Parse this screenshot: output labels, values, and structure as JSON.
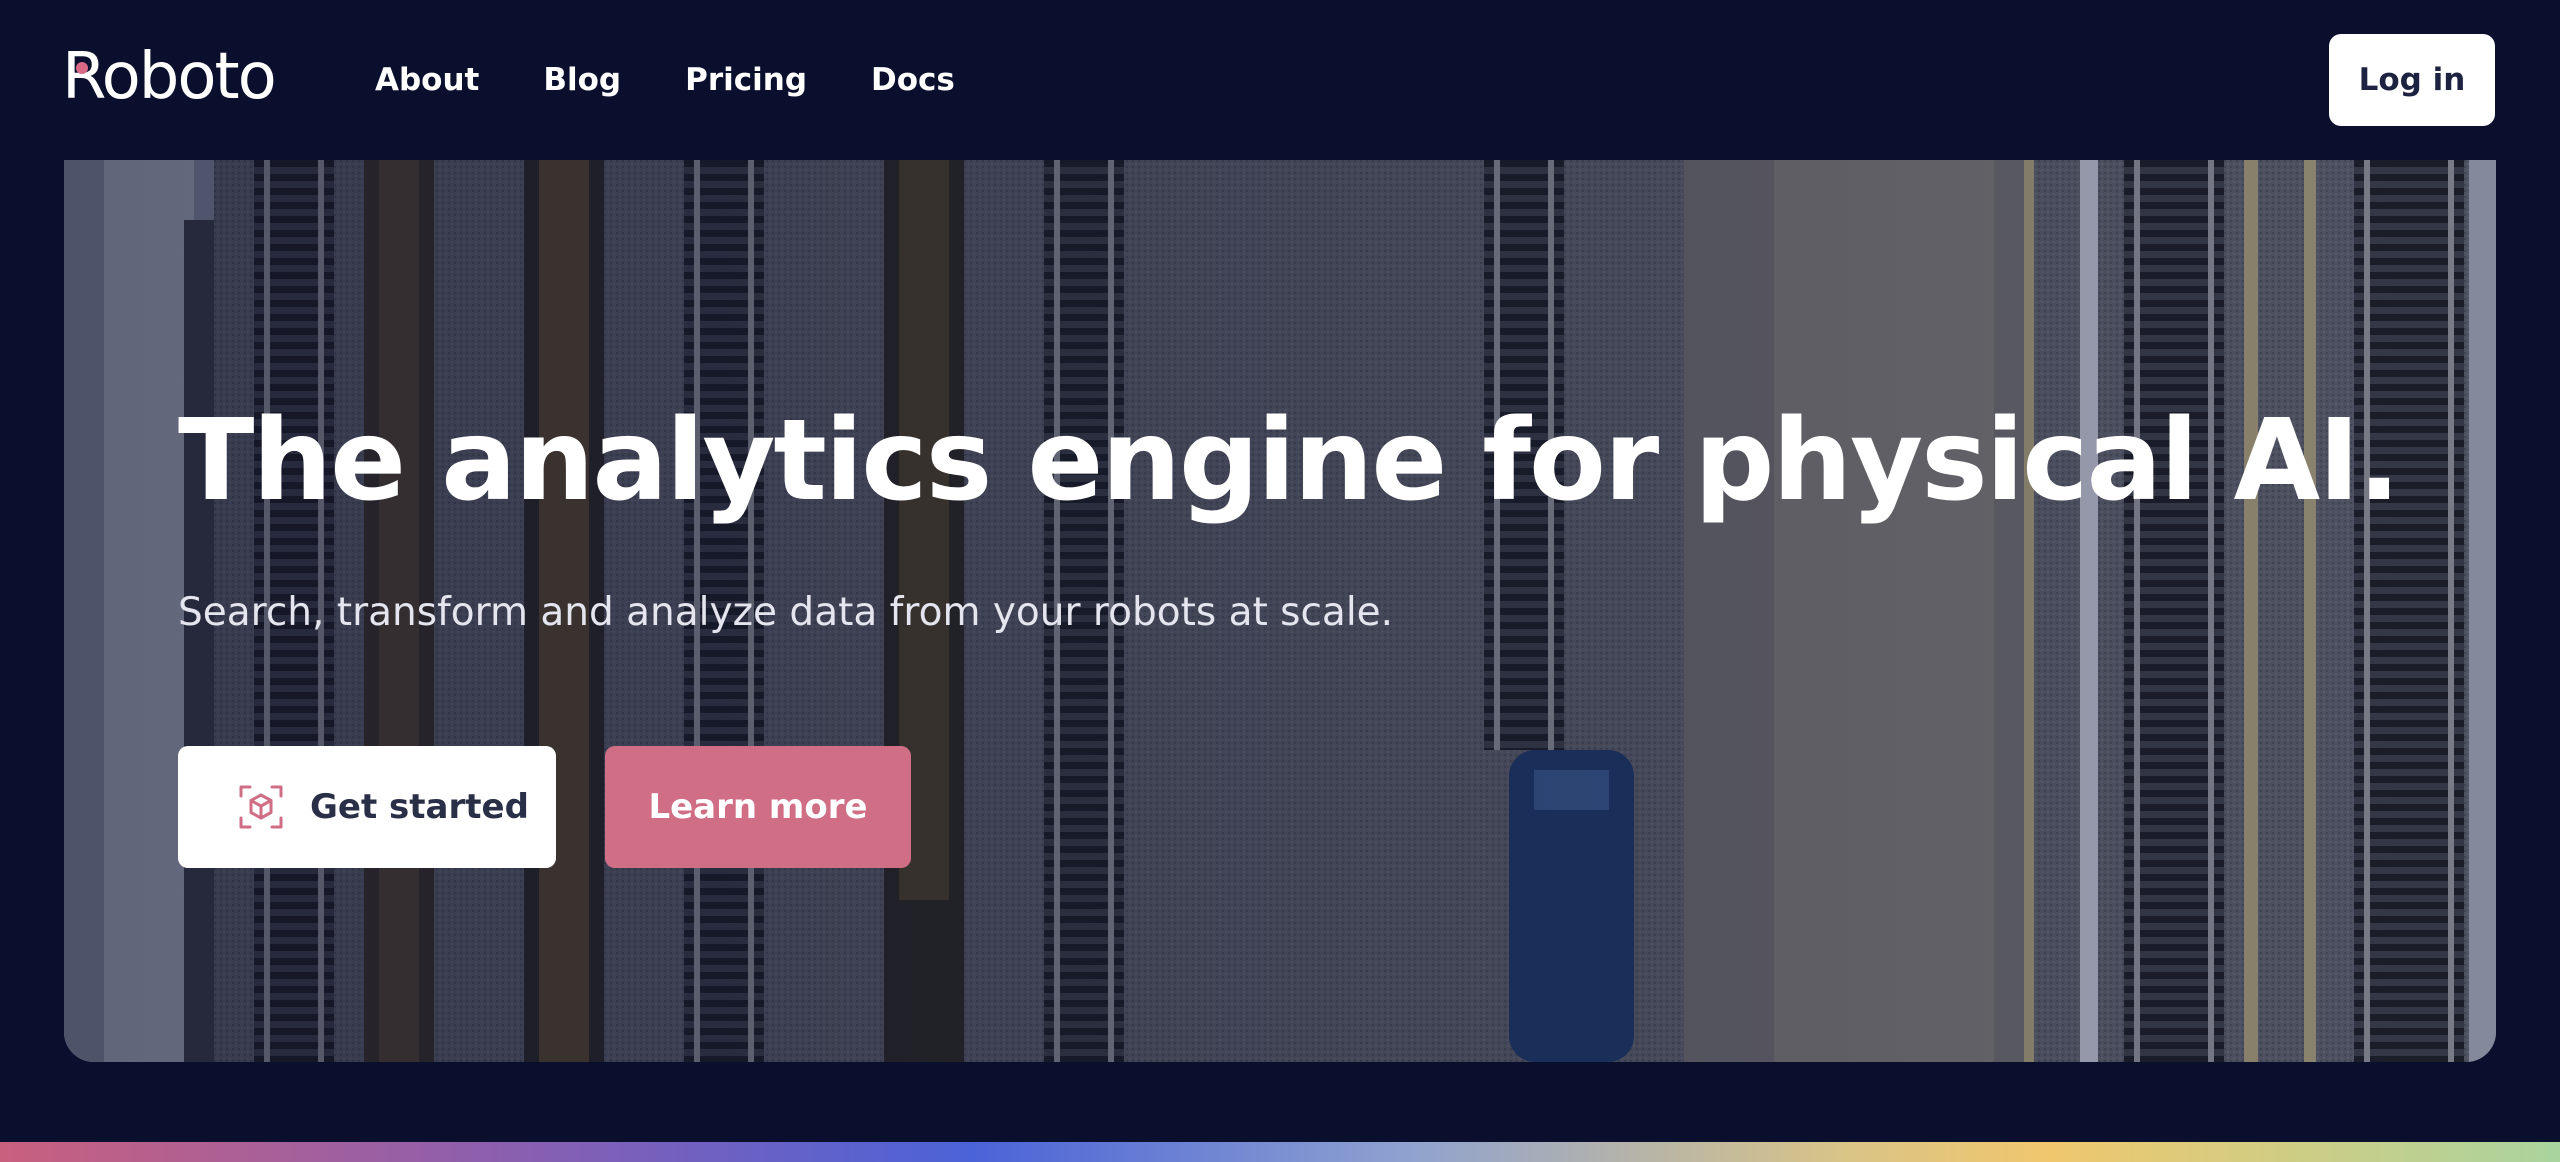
{
  "nav": {
    "logo": "Roboto",
    "links": [
      "About",
      "Blog",
      "Pricing",
      "Docs"
    ],
    "login_label": "Log in"
  },
  "hero": {
    "title": "The analytics engine for physical AI.",
    "subtitle": "Search, transform and analyze data from your robots at scale.",
    "primary_cta": "Get started",
    "secondary_cta": "Learn more",
    "background": "aerial-rail-yard-image"
  },
  "colors": {
    "page_bg": "#0b0f2e",
    "accent_pink": "#d06e86",
    "button_text_dark": "#2a2f48"
  },
  "icons": {
    "primary_cta_icon": "cube-icon"
  }
}
